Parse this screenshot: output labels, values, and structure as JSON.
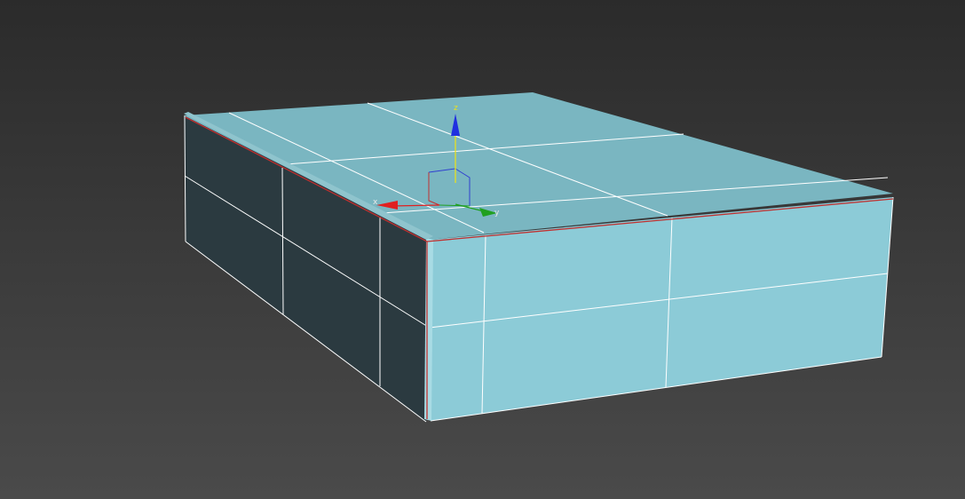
{
  "viewport": {
    "background_top_color": "#2b2b2b",
    "background_bottom_color": "#4a4a4a"
  },
  "object": {
    "top_face_color": "#7ab6c1",
    "front_face_color": "#8ccbd7",
    "side_face_color": "#2b3a40",
    "wire_color": "#ffffff",
    "selected_edge_color": "#c0302f"
  },
  "gizmo": {
    "x_label": "x",
    "y_label": "y",
    "z_label": "z",
    "x_color": "#e02020",
    "y_color": "#20a020",
    "z_color": "#2030e0",
    "z_label_color": "#e8e020"
  }
}
